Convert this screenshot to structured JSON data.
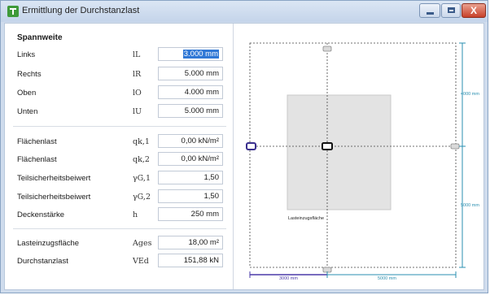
{
  "window": {
    "title": "Ermittlung der Durchstanzlast",
    "close_glyph": "X"
  },
  "spannweite": {
    "heading": "Spannweite",
    "rows": [
      {
        "label": "Links",
        "symbol": "lL",
        "value": "3.000 mm"
      },
      {
        "label": "Rechts",
        "symbol": "lR",
        "value": "5.000 mm"
      },
      {
        "label": "Oben",
        "symbol": "lO",
        "value": "4.000 mm"
      },
      {
        "label": "Unten",
        "symbol": "lU",
        "value": "5.000 mm"
      }
    ]
  },
  "lasten": {
    "rows": [
      {
        "label": "Flächenlast",
        "symbol": "qk,1",
        "value": "0,00 kN/m²"
      },
      {
        "label": "Flächenlast",
        "symbol": "qk,2",
        "value": "0,00 kN/m²"
      },
      {
        "label": "Teilsicherheitsbeiwert",
        "symbol": "γG,1",
        "value": "1,50"
      },
      {
        "label": "Teilsicherheitsbeiwert",
        "symbol": "γG,2",
        "value": "1,50"
      },
      {
        "label": "Deckenstärke",
        "symbol": "h",
        "value": "250 mm"
      }
    ]
  },
  "ergebnis": {
    "rows": [
      {
        "label": "Lasteinzugsfläche",
        "symbol": "Ages",
        "value": "18,00 m²"
      },
      {
        "label": "Durchstanzlast",
        "symbol": "VEd",
        "value": "151,88 kN"
      }
    ]
  },
  "diagram": {
    "area_label": "Lasteinzugsfläche",
    "dim_oben": "4000 mm",
    "dim_unten": "5000 mm",
    "dim_links": "3000 mm",
    "dim_rechts": "5000 mm",
    "colors": {
      "dimension": "#2a8fb0",
      "selected_dimension": "#4a3aa8",
      "area": "#e3e3e3"
    }
  }
}
